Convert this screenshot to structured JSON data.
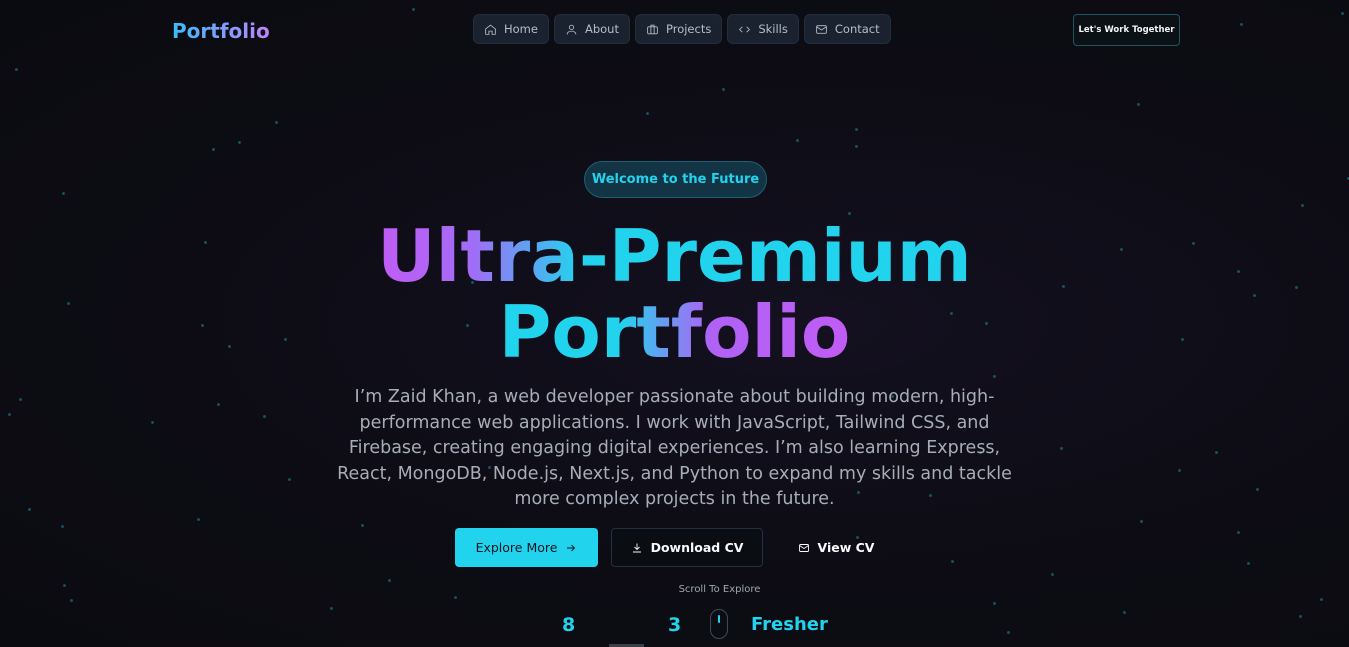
{
  "header": {
    "logo": "Portfolio",
    "nav": [
      {
        "label": "Home",
        "icon": "home-icon"
      },
      {
        "label": "About",
        "icon": "user-icon"
      },
      {
        "label": "Projects",
        "icon": "briefcase-icon"
      },
      {
        "label": "Skills",
        "icon": "code-icon"
      },
      {
        "label": "Contact",
        "icon": "mail-icon"
      }
    ],
    "cta_label": "Let's Work Together"
  },
  "hero": {
    "badge": "Welcome to the Future",
    "title_line1": "Ultra-Premium",
    "title_line2": "Portfolio",
    "description": "I’m Zaid Khan, a web developer passionate about building modern, high-performance web applications. I work with JavaScript, Tailwind CSS, and Firebase, creating engaging digital experiences. I’m also learning Express, React, MongoDB, Node.js, Next.js, and Python to expand my skills and tackle more complex projects in the future.",
    "buttons": {
      "explore": "Explore More",
      "download": "Download CV",
      "view": "View CV"
    },
    "scroll_hint": "Scroll To Explore",
    "stats": [
      "8",
      "3",
      "Fresher"
    ]
  },
  "colors": {
    "accent": "#22d3ee",
    "gradient_purple": "#c15cf5",
    "background": "#0d0c14"
  }
}
